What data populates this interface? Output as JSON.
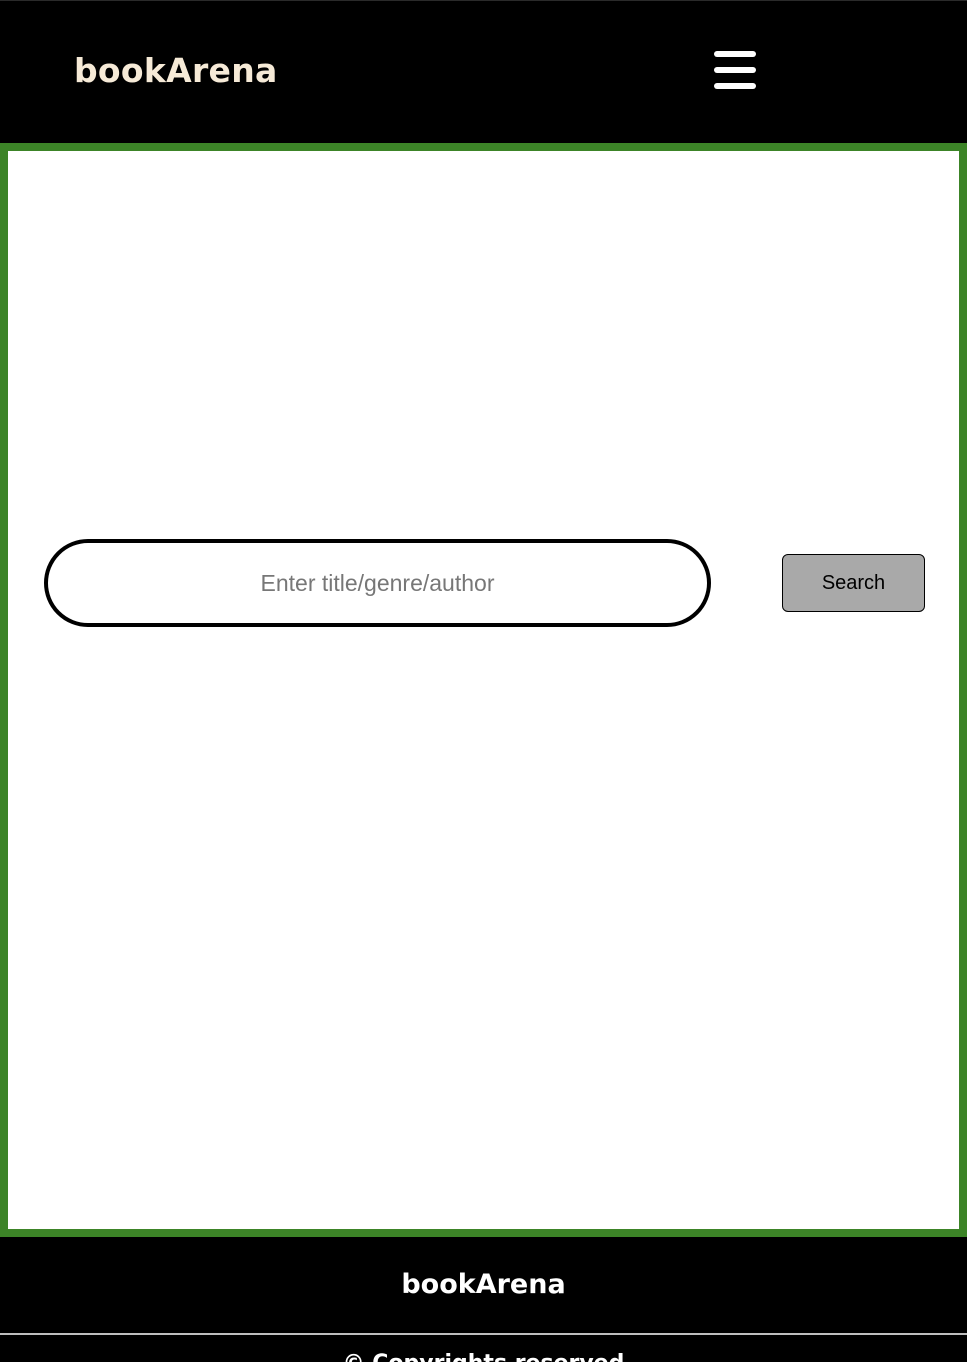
{
  "header": {
    "brand": "bookArena",
    "menu_icon": "hamburger-menu-icon",
    "brand_color": "#f6ead7"
  },
  "main": {
    "border_color": "#3c8427",
    "search": {
      "placeholder": "Enter title/genre/author",
      "value": "",
      "button_label": "Search"
    }
  },
  "footer": {
    "brand": "bookArena",
    "copyright": "© Copyrights reserved"
  }
}
